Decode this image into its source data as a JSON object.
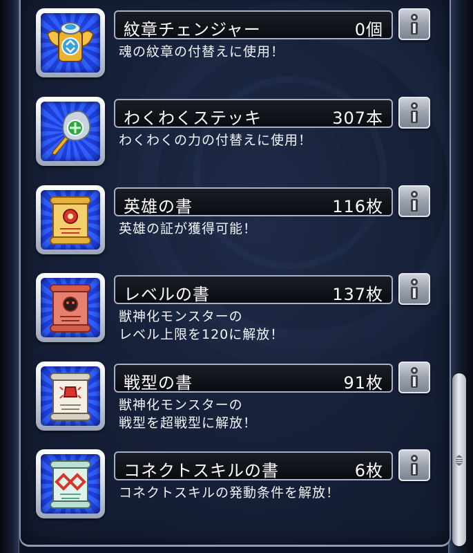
{
  "items": [
    {
      "name": "紋章チェンジャー",
      "count": "0個",
      "desc1": "魂の紋章の付替えに使用！",
      "desc2": "",
      "icon": "emblem-changer-icon"
    },
    {
      "name": "わくわくステッキ",
      "count": "307本",
      "desc1": "わくわくの力の付替えに使用！",
      "desc2": "",
      "icon": "waku-waku-stick-icon"
    },
    {
      "name": "英雄の書",
      "count": "116枚",
      "desc1": "英雄の証が獲得可能！",
      "desc2": "",
      "icon": "hero-scroll-icon"
    },
    {
      "name": "レベルの書",
      "count": "137枚",
      "desc1": "獣神化モンスターの",
      "desc2": "レベル上限を120に解放！",
      "icon": "level-scroll-icon"
    },
    {
      "name": "戦型の書",
      "count": "91枚",
      "desc1": "獣神化モンスターの",
      "desc2": "戦型を超戦型に解放！",
      "icon": "battle-type-scroll-icon"
    },
    {
      "name": "コネクトスキルの書",
      "count": "6枚",
      "desc1": "コネクトスキルの発動条件を解放！",
      "desc2": "",
      "icon": "connect-skill-scroll-icon"
    }
  ],
  "colors": {
    "panel_bg": "#17213a",
    "tile_blue": "#2f5fff",
    "name_bar_border": "#a8b2c4"
  },
  "scrollbar": {
    "position": 0.85
  }
}
